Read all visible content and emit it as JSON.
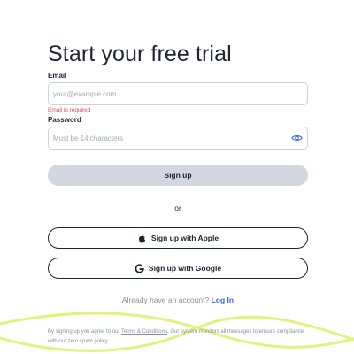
{
  "title": "Start your free trial",
  "email": {
    "label": "Email",
    "placeholder": "your@example.com",
    "value": "",
    "error": "Email is required"
  },
  "password": {
    "label": "Password",
    "placeholder": "Must be 14 characters",
    "value": ""
  },
  "buttons": {
    "signup": "Sign up",
    "apple": "Sign up with Apple",
    "google": "Sign up with Google"
  },
  "divider_text": "or",
  "account": {
    "prompt": "Already have an account?",
    "login": "Log In"
  },
  "legal": {
    "before": "By signing up you agree to our ",
    "link": "Terms & Conditions",
    "after": ". Our system monitors all messages to ensure compliance with our zero spam policy."
  },
  "colors": {
    "text": "#1f2433",
    "error": "#e0455a",
    "link": "#3f66d8",
    "button_disabled": "#d3d7df",
    "accent_wave": "#e4f07a"
  },
  "icons": {
    "password_toggle": "eye-icon",
    "apple": "apple-logo-icon",
    "google": "google-logo-icon"
  }
}
